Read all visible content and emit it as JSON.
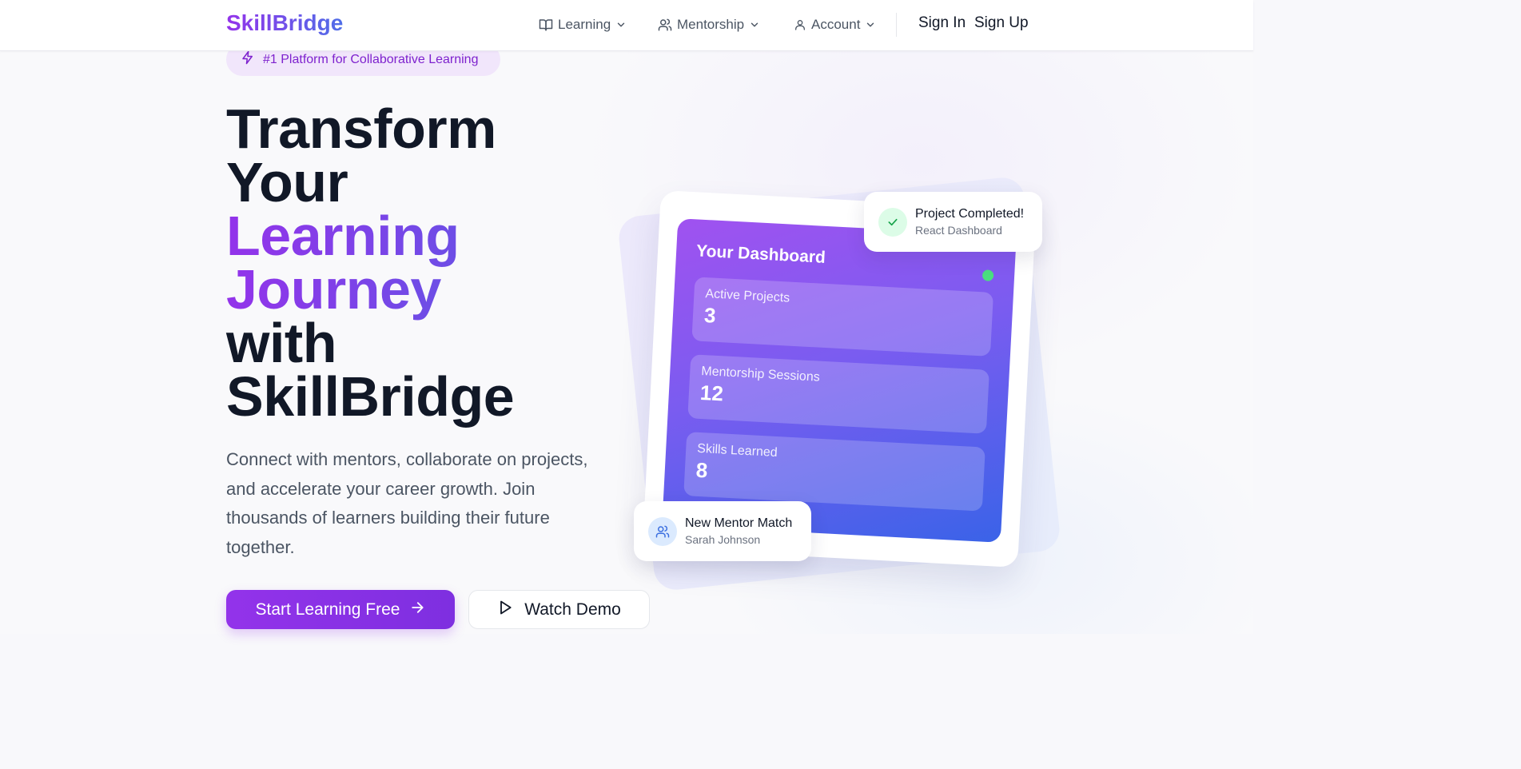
{
  "brand": {
    "name": "SkillBridge"
  },
  "nav": {
    "items": [
      {
        "label": "Learning",
        "icon": "book-icon"
      },
      {
        "label": "Mentorship",
        "icon": "users-icon"
      },
      {
        "label": "Account",
        "icon": "user-icon"
      }
    ],
    "sign_in": "Sign In",
    "sign_up": "Sign Up"
  },
  "badge": {
    "text": "#1 Platform for Collaborative Learning",
    "icon": "lightning-icon"
  },
  "hero": {
    "title_lines": [
      "Transform",
      "Your",
      "Learning",
      "Journey",
      "with",
      "SkillBridge"
    ],
    "subtitle": "Connect with mentors, collaborate on projects, and accelerate your career growth. Join thousands of learners building their future together.",
    "primary_cta": "Start Learning Free",
    "secondary_cta": "Watch Demo"
  },
  "dashboard": {
    "title": "Your Dashboard",
    "stats": [
      {
        "label": "Active Projects",
        "value": "3"
      },
      {
        "label": "Mentorship Sessions",
        "value": "12"
      },
      {
        "label": "Skills Learned",
        "value": "8"
      }
    ]
  },
  "notifications": {
    "project": {
      "title": "Project Completed!",
      "subtitle": "React Dashboard"
    },
    "mentor": {
      "title": "New Mentor Match",
      "subtitle": "Sarah Johnson"
    }
  },
  "colors": {
    "brand_purple": "#9333ea",
    "brand_blue": "#4f6ee8",
    "status_green": "#4ade80"
  }
}
